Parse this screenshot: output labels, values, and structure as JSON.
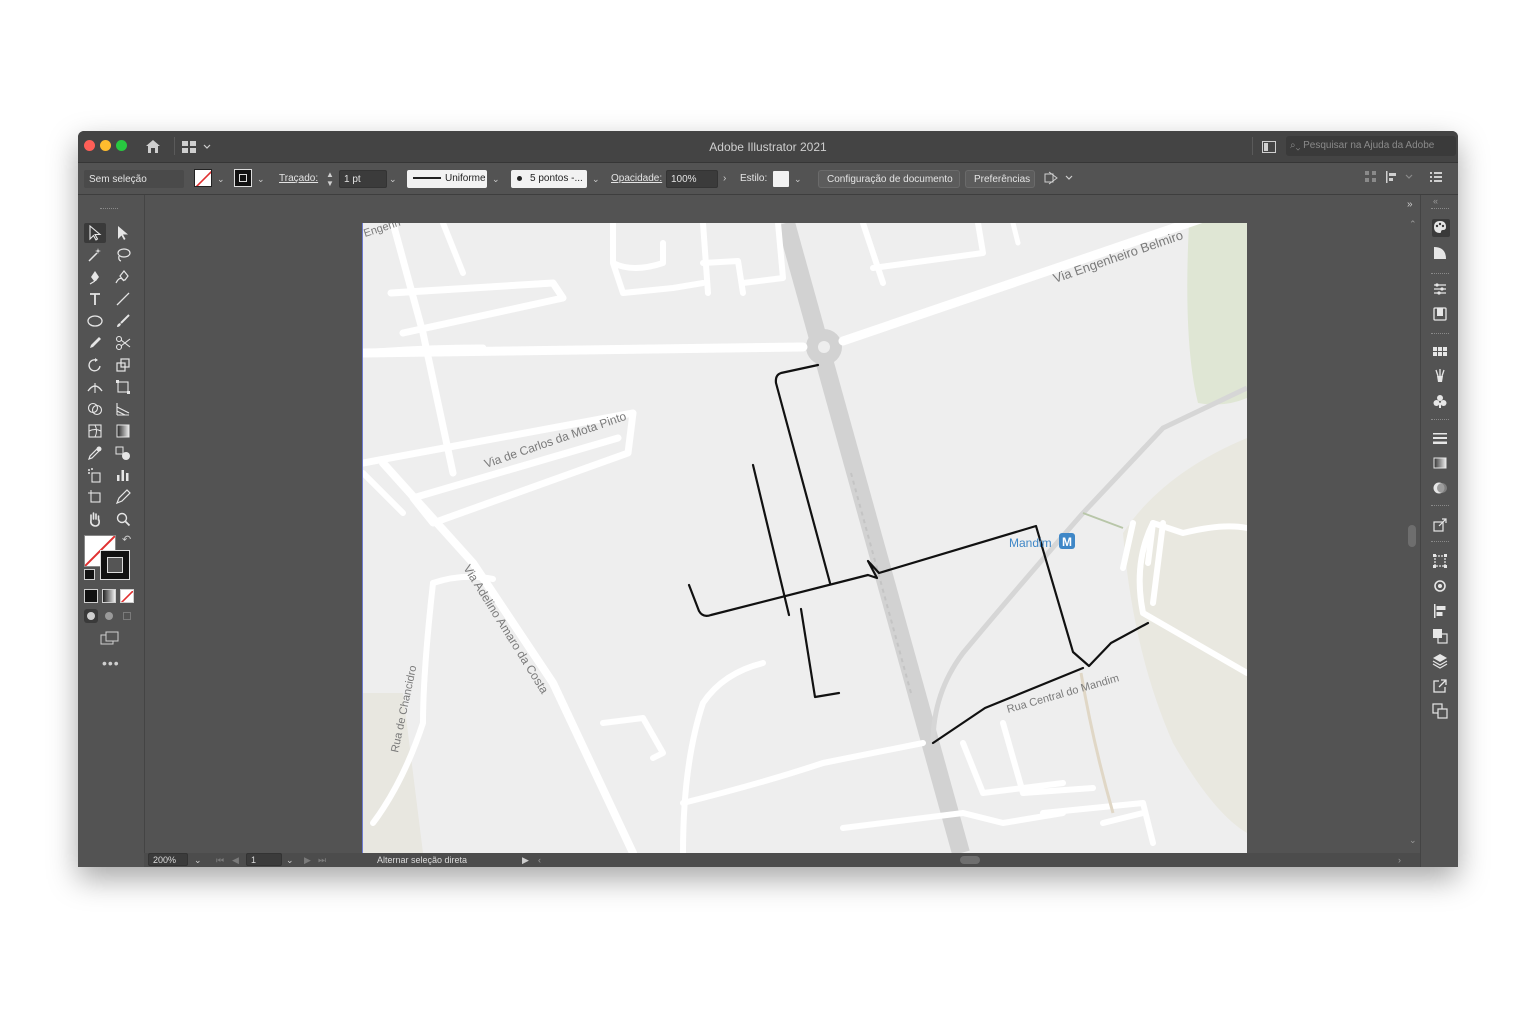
{
  "window": {
    "title": "Adobe Illustrator 2021",
    "search_placeholder": "Pesquisar na Ajuda da Adobe"
  },
  "control_bar": {
    "selection_status": "Sem seleção",
    "stroke_label": "Traçado:",
    "stroke_weight": "1 pt",
    "stroke_profile": "Uniforme",
    "brush_definition": "5 pontos -...",
    "opacity_label": "Opacidade:",
    "opacity_value": "100%",
    "style_label": "Estilo:",
    "doc_setup_button": "Configuração de documento",
    "preferences_button": "Preferências"
  },
  "status_bar": {
    "zoom": "200%",
    "artboard_number": "1",
    "tool_hint": "Alternar seleção direta"
  },
  "map_labels": {
    "street_top_left": "Engenh",
    "via_engenheiro": "Via Engenheiro Belmiro",
    "via_carlos": "Via de Carlos da Mota Pinto",
    "via_adelino": "Via Adelino Amaro da Costa",
    "rua_chancidro": "Rua de Chancidro",
    "rua_central": "Rua Central do Mandim",
    "metro_station": "Mandim",
    "metro_badge": "M"
  },
  "colors": {
    "ui_dark": "#535353",
    "titlebar": "#444444",
    "artboard_bg": "#eeeeee",
    "road": "#ffffff",
    "rail": "#d2d2d2",
    "drawn_path": "#111111",
    "metro_blue": "#3f87c7",
    "park_green": "#dfe6d4"
  }
}
